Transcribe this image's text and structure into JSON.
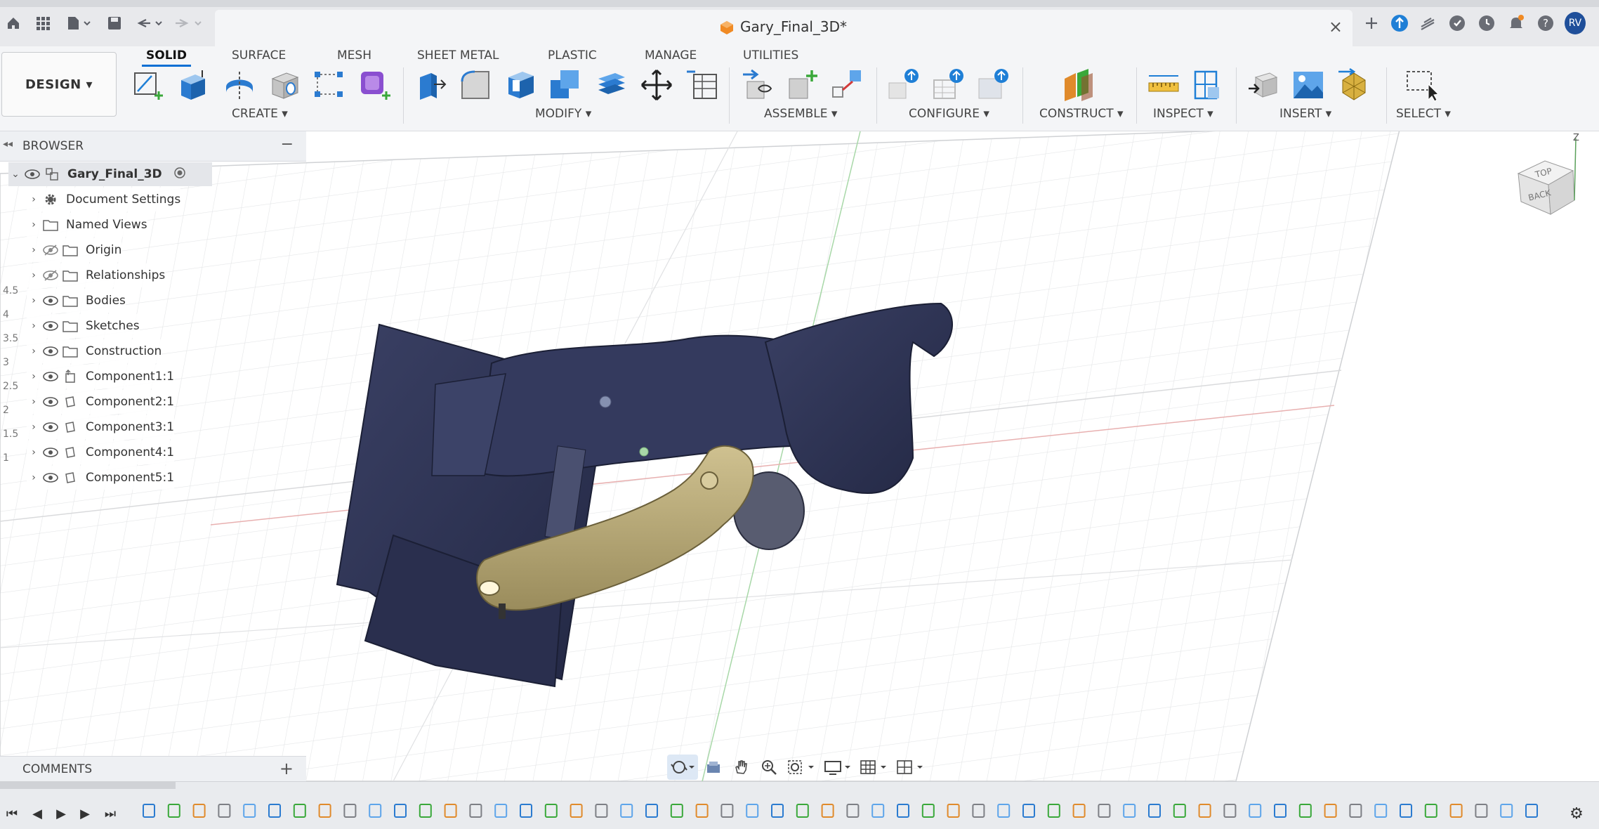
{
  "document": {
    "title": "Gary_Final_3D*",
    "close_label": "×"
  },
  "user": {
    "initials": "RV"
  },
  "workspace": {
    "label": "DESIGN ▾"
  },
  "ribbon_tabs": [
    {
      "label": "SOLID",
      "active": true
    },
    {
      "label": "SURFACE"
    },
    {
      "label": "MESH"
    },
    {
      "label": "SHEET METAL"
    },
    {
      "label": "PLASTIC"
    },
    {
      "label": "MANAGE"
    },
    {
      "label": "UTILITIES"
    }
  ],
  "ribbon_groups": {
    "create": "CREATE ▾",
    "modify": "MODIFY ▾",
    "assemble": "ASSEMBLE ▾",
    "configure": "CONFIGURE ▾",
    "construct": "CONSTRUCT ▾",
    "inspect": "INSPECT ▾",
    "insert": "INSERT ▾",
    "select": "SELECT ▾"
  },
  "browser": {
    "title": "BROWSER",
    "collapse_label": "−",
    "root": "Gary_Final_3D",
    "items": [
      {
        "label": "Document Settings",
        "icon": "gear-icon",
        "eye": "none"
      },
      {
        "label": "Named Views",
        "icon": "folder-icon",
        "eye": "none"
      },
      {
        "label": "Origin",
        "icon": "folder-icon",
        "eye": "hidden"
      },
      {
        "label": "Relationships",
        "icon": "folder-icon",
        "eye": "hidden"
      },
      {
        "label": "Bodies",
        "icon": "folder-icon",
        "eye": "visible"
      },
      {
        "label": "Sketches",
        "icon": "folder-icon",
        "eye": "visible"
      },
      {
        "label": "Construction",
        "icon": "folder-icon",
        "eye": "visible"
      },
      {
        "label": "Component1:1",
        "icon": "component-icon",
        "eye": "visible"
      },
      {
        "label": "Component2:1",
        "icon": "component-icon",
        "eye": "visible"
      },
      {
        "label": "Component3:1",
        "icon": "component-icon",
        "eye": "visible"
      },
      {
        "label": "Component4:1",
        "icon": "component-icon",
        "eye": "visible"
      },
      {
        "label": "Component5:1",
        "icon": "component-icon",
        "eye": "visible"
      }
    ]
  },
  "comments": {
    "title": "COMMENTS",
    "add_label": "+"
  },
  "viewcube": {
    "top": "TOP",
    "back": "BACK",
    "axis": "Z"
  },
  "grid_axis_labels": [
    "4.5",
    "4",
    "3.5",
    "3",
    "2.5",
    "2",
    "1.5",
    "1"
  ],
  "colors": {
    "accent": "#0b6fd4",
    "body_dark": "#2e3454",
    "bracket_gold": "#b5a675",
    "grid": "#e3e4e6"
  }
}
